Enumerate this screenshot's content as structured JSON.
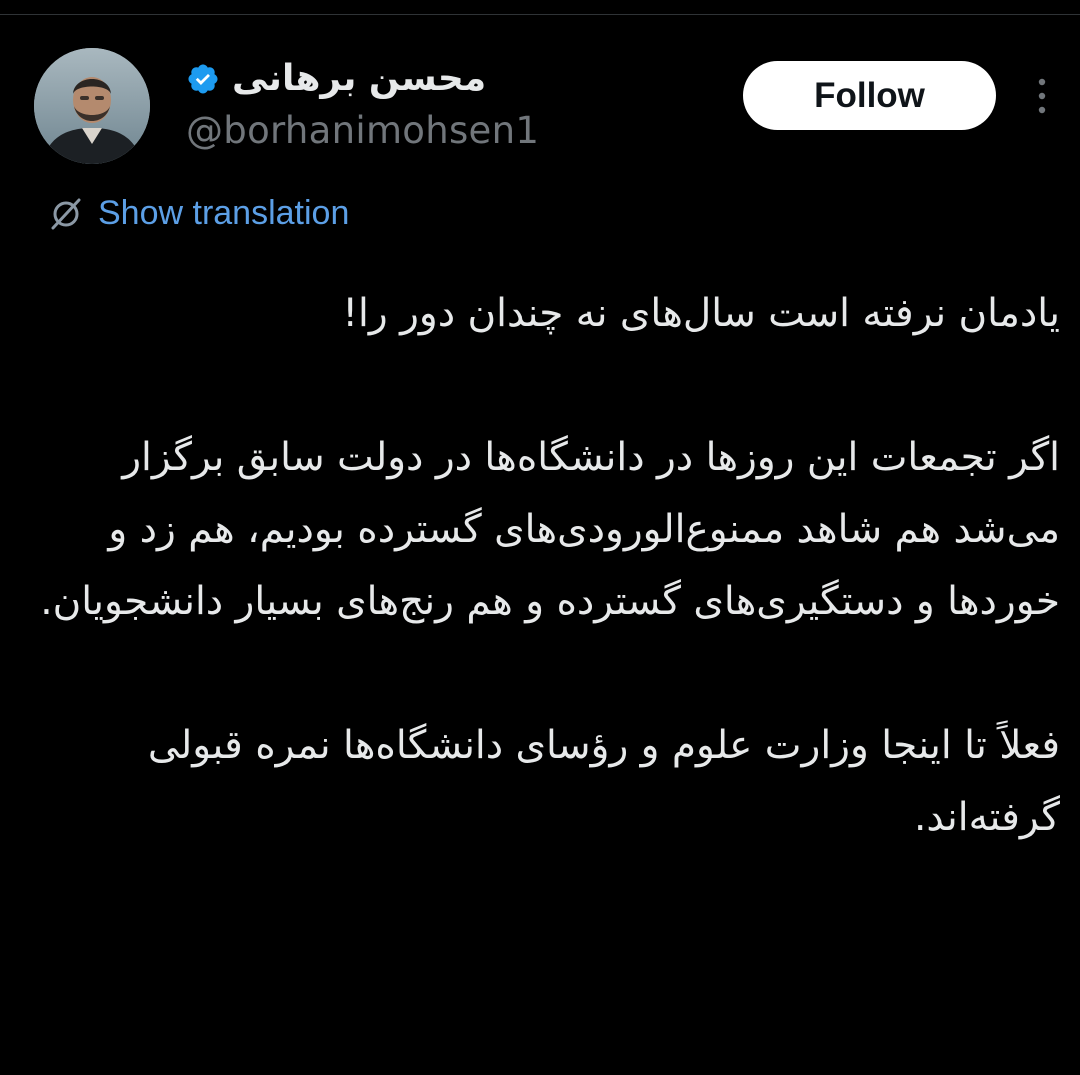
{
  "author": {
    "display_name": "محسن برهانی",
    "handle": "@borhanimohsen1",
    "verified": true
  },
  "actions": {
    "follow_label": "Follow",
    "translate_label": "Show translation"
  },
  "icons": {
    "verified": "verified-badge-icon",
    "more": "more-vertical-icon",
    "translate": "translate-globe-icon"
  },
  "colors": {
    "background": "#000000",
    "text": "#e7e9ea",
    "muted": "#71767b",
    "link": "#5c9fe6",
    "verified": "#1d9bf0",
    "follow_bg": "#ffffff"
  },
  "tweet": {
    "paragraphs": [
      "یادمان نرفته است سال‌های نه چندان دور را!",
      "اگر تجمعات این روزها در دانشگاه‌ها در دولت سابق برگزار می‌شد هم شاهد ممنوع‌الورودی‌های گسترده بودیم، هم زد و خوردها و دستگیری‌های گسترده و هم رنج‌های بسیار دانشجویان.",
      "فعلاً تا اینجا وزارت علوم و رؤسای دانشگاه‌ها نمره قبولی گرفته‌اند."
    ]
  }
}
